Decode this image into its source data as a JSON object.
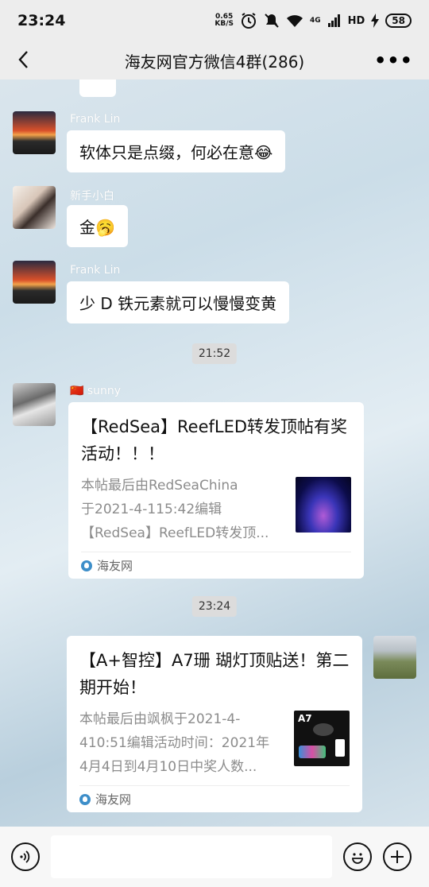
{
  "status_bar": {
    "time": "23:24",
    "net_speed_value": "0.65",
    "net_speed_unit": "KB/S",
    "network": "4G",
    "volte": "HD",
    "battery": "58"
  },
  "header": {
    "title": "海友网官方微信4群(286)"
  },
  "messages": [
    {
      "sender": "Frank Lin",
      "text": "软体只是点缀，何必在意😂"
    },
    {
      "sender": "新手小白",
      "text": "金🥱"
    },
    {
      "sender": "Frank Lin",
      "text": "少 D 铁元素就可以慢慢变黄"
    }
  ],
  "timestamps": [
    "21:52",
    "23:24"
  ],
  "card1": {
    "sender": "🇨🇳 sunny",
    "title": "【RedSea】ReefLED转发顶帖有奖活动！！！",
    "desc_lines": [
      "本帖最后由RedSeaChina",
      "于2021-4-115:42编辑",
      "【RedSea】ReefLED转发顶..."
    ],
    "source": "海友网"
  },
  "card2": {
    "title": "【A+智控】A7珊 瑚灯顶贴送！第二期开始！",
    "desc_lines": [
      "本帖最后由飒枫于2021-4-",
      "410:51编辑活动时间：2021年",
      "4月4日到4月10日中奖人数..."
    ],
    "thumb_label": "A7",
    "source": "海友网"
  },
  "colors": {
    "bar_bg": "#ededed",
    "bubble_bg": "#ffffff",
    "timestamp_bg": "#dcdcdc"
  },
  "icons": [
    "back-arrow-icon",
    "more-icon",
    "voice-icon",
    "emoji-icon",
    "add-icon",
    "alarm-icon",
    "mute-icon",
    "wifi-icon",
    "signal-icon",
    "charging-icon"
  ]
}
